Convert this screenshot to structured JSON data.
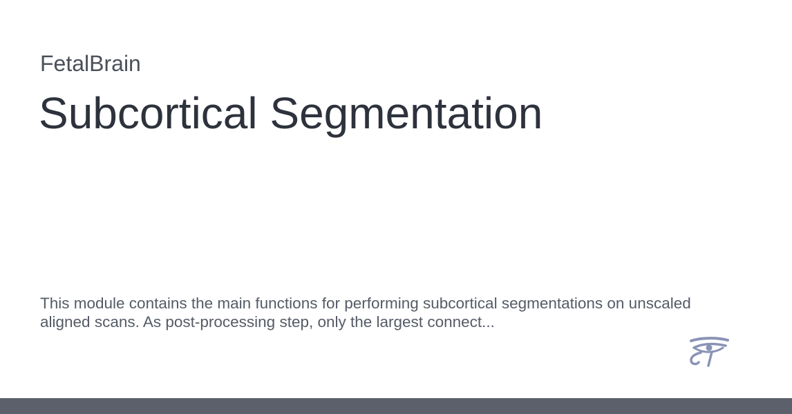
{
  "site": {
    "name": "FetalBrain"
  },
  "page": {
    "title": "Subcortical Segmentation",
    "description": "This module contains the main functions for performing subcortical segmentations on unscaled aligned scans. As post-processing step, only the largest connect..."
  },
  "logo": {
    "icon": "eye-of-horus-icon",
    "color": "#8a93b5"
  },
  "footer": {
    "color": "#5b606b"
  }
}
